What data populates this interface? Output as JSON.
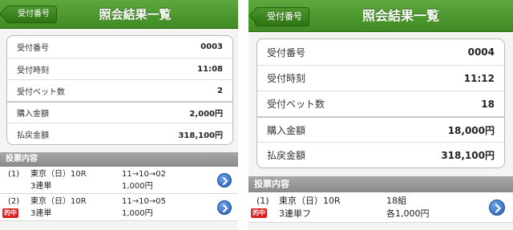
{
  "left": {
    "back_label": "受付番号",
    "title": "照会結果一覧",
    "summary": [
      {
        "label": "受付番号",
        "value": "0003"
      },
      {
        "label": "受付時刻",
        "value": "11:08"
      },
      {
        "label": "受付ベット数",
        "value": "2"
      },
      {
        "label": "購入金額",
        "value": "2,000円"
      },
      {
        "label": "払戻金額",
        "value": "318,100円"
      }
    ],
    "section_title": "投票内容",
    "bets": [
      {
        "index": "(1)",
        "race": "東京（日）10R",
        "combo": "11→10→02",
        "type": "3連単",
        "amount": "1,000円",
        "hit": ""
      },
      {
        "index": "(2)",
        "race": "東京（日）10R",
        "combo": "11→10→05",
        "type": "3連単",
        "amount": "1,000円",
        "hit": "的中"
      }
    ]
  },
  "right": {
    "back_label": "受付番号",
    "title": "照会結果一覧",
    "summary": [
      {
        "label": "受付番号",
        "value": "0004"
      },
      {
        "label": "受付時刻",
        "value": "11:12"
      },
      {
        "label": "受付ベット数",
        "value": "18"
      },
      {
        "label": "購入金額",
        "value": "18,000円"
      },
      {
        "label": "払戻金額",
        "value": "318,100円"
      }
    ],
    "section_title": "投票内容",
    "bets": [
      {
        "index": "(1)",
        "race": "東京（日）10R",
        "combo": "18組",
        "type": "3連単フ",
        "amount": "各1,000円",
        "hit": "的中"
      }
    ]
  },
  "colors": {
    "navbar": "#4a9a2e",
    "hit_badge": "#d91f1f",
    "detail_button": "#2f6fc9",
    "section_header": "#999999"
  },
  "icons": {
    "back": "back-arrow-button",
    "detail": "chevron-right-circle-icon"
  }
}
